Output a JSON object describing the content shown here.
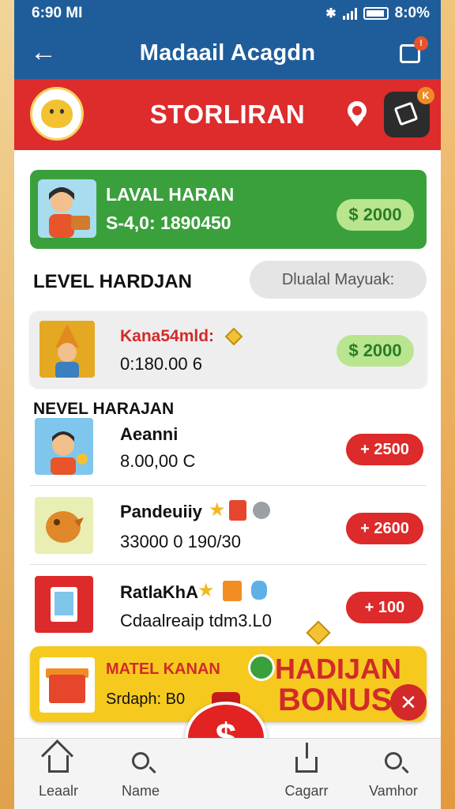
{
  "status": {
    "time": "6:90 MI",
    "battery": "8:0%"
  },
  "appbar": {
    "title": "Madaail Acagdn",
    "share_badge": "!"
  },
  "store": {
    "title": "STORLIRAN",
    "edit_badge": "K"
  },
  "hero": {
    "title": "LAVAL HARAN",
    "value": "S-4,0: 1890450",
    "price": "$ 2000"
  },
  "section1": {
    "title": "LEVEL HARDJAN",
    "search_placeholder": "Dlualal Mayuak:"
  },
  "featured": {
    "name": "Kana54mld:",
    "value": "0:180.00 6",
    "price": "$ 2000"
  },
  "section2": {
    "title": "NEVEL HARAJAN"
  },
  "items": [
    {
      "name": "Aeanni",
      "value": "8.00,00 C",
      "price": "+ 2500"
    },
    {
      "name": "Pandeuiiy",
      "value": "33000 0 190/30",
      "price": "+ 2600"
    },
    {
      "name": "RatlaKhA",
      "value": "Cdaalreaip tdm3.L0",
      "price": "+ 100"
    }
  ],
  "bonus": {
    "title": "MATEL KANAN",
    "subtitle": "Srdaph: B0",
    "headline1": "HADIJAN",
    "headline2": "BONUS"
  },
  "moneybag": {
    "symbol": "$"
  },
  "nav": [
    {
      "label": "Leaalr",
      "icon": "home-icon"
    },
    {
      "label": "Name",
      "icon": "search-icon"
    },
    {
      "label": "Cagarr",
      "icon": "upload-icon"
    },
    {
      "label": "Vamhor",
      "icon": "search-icon"
    }
  ],
  "colors": {
    "primary": "#1f5d9a",
    "accent_red": "#de2b2b",
    "green": "#3aa03c",
    "bonus_yellow": "#f6c91f"
  }
}
